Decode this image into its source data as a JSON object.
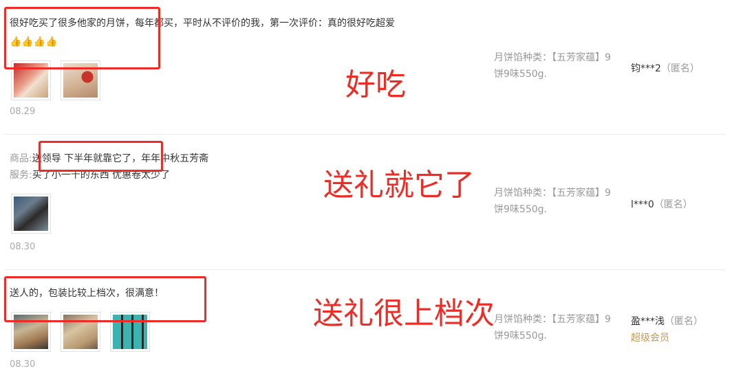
{
  "reviews": [
    {
      "content": "很好吃买了很多他家的月饼，每年都买，平时从不评价的我，第一次评价：真的很好吃超爱",
      "emoji": "👍👍👍👍",
      "date": "08.29",
      "sku": "月饼馅种类：【五芳家蕴】9饼9味550g.",
      "user": "钧***2",
      "anon": "（匿名）",
      "annotation": "好吃"
    },
    {
      "product_label": "商品:",
      "product_text": "送领导 下半年就靠它了，年年中秋五芳斋",
      "service_label": "服务:",
      "service_text": "买了小一千的东西 优惠卷太少了",
      "date": "08.30",
      "sku": "月饼馅种类：【五芳家蕴】9饼9味550g.",
      "user": "l***0",
      "anon": "（匿名）",
      "annotation": "送礼就它了"
    },
    {
      "content": "送人的，包装比较上档次，很满意！",
      "date": "08.30",
      "sku": "月饼馅种类：【五芳家蕴】9饼9味550g.",
      "user": "盈***浅",
      "anon": "（匿名）",
      "badge": "超级会员",
      "annotation": "送礼很上档次"
    }
  ],
  "colors": {
    "annotation_red": "#ee2b24",
    "vip_gold": "#c19a58"
  }
}
